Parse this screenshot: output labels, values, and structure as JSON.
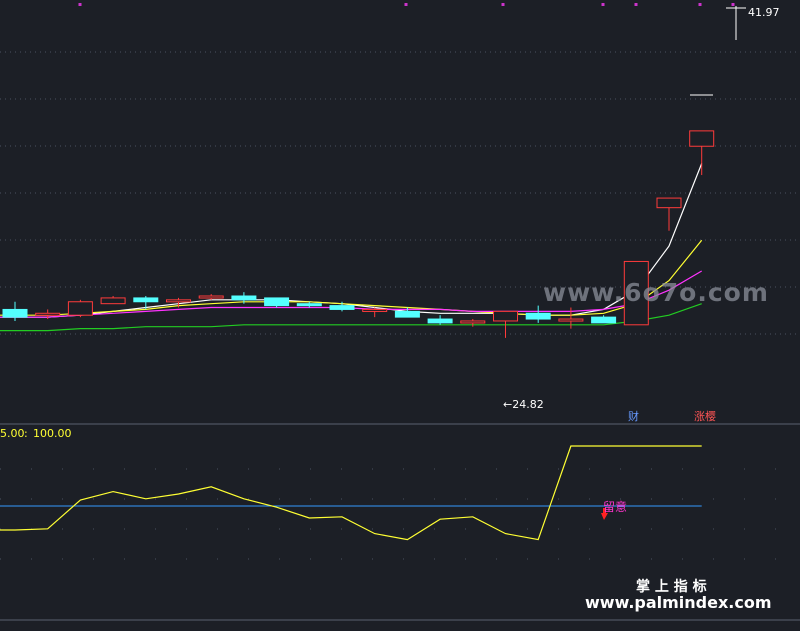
{
  "colors": {
    "background": "#1c1f26",
    "grid": "#4a5060",
    "up": "#ff3b3b",
    "down": "#54ffff",
    "ma_white": "#ffffff",
    "ma_yellow": "#ffff33",
    "ma_magenta": "#ff33ff",
    "ma_green": "#22cc22",
    "osc_line": "#ffff33",
    "osc_ref": "#3399ff",
    "signal_text": "#ff33cc",
    "signal_arrow": "#ff2222",
    "label_blue": "#6699ff",
    "label_red": "#ff5555",
    "watermark": "#8a8f99"
  },
  "chart_data": [
    {
      "type": "candlestick",
      "title": "",
      "ylim": [
        22,
        42
      ],
      "x": [
        "1",
        "2",
        "3",
        "4",
        "5",
        "6",
        "7",
        "8",
        "9",
        "10",
        "11",
        "12",
        "13",
        "14",
        "15",
        "16",
        "17",
        "18",
        "19",
        "20",
        "21",
        "22"
      ],
      "candles": [
        {
          "o": 26.3,
          "h": 26.7,
          "l": 25.7,
          "c": 25.9
        },
        {
          "o": 26.0,
          "h": 26.3,
          "l": 25.8,
          "c": 26.1
        },
        {
          "o": 26.0,
          "h": 26.8,
          "l": 25.9,
          "c": 26.7
        },
        {
          "o": 26.6,
          "h": 27.0,
          "l": 26.6,
          "c": 26.9
        },
        {
          "o": 26.9,
          "h": 27.0,
          "l": 26.3,
          "c": 26.7
        },
        {
          "o": 26.7,
          "h": 26.9,
          "l": 26.4,
          "c": 26.8
        },
        {
          "o": 26.9,
          "h": 27.1,
          "l": 26.8,
          "c": 27.0
        },
        {
          "o": 27.0,
          "h": 27.2,
          "l": 26.6,
          "c": 26.8
        },
        {
          "o": 26.9,
          "h": 26.9,
          "l": 26.4,
          "c": 26.5
        },
        {
          "o": 26.6,
          "h": 26.7,
          "l": 26.4,
          "c": 26.5
        },
        {
          "o": 26.5,
          "h": 26.7,
          "l": 26.2,
          "c": 26.3
        },
        {
          "o": 26.2,
          "h": 26.4,
          "l": 25.9,
          "c": 26.3
        },
        {
          "o": 26.2,
          "h": 26.4,
          "l": 25.9,
          "c": 25.9
        },
        {
          "o": 25.8,
          "h": 26.0,
          "l": 25.5,
          "c": 25.6
        },
        {
          "o": 25.6,
          "h": 25.8,
          "l": 25.4,
          "c": 25.7
        },
        {
          "o": 25.7,
          "h": 26.2,
          "l": 24.82,
          "c": 26.2
        },
        {
          "o": 26.1,
          "h": 26.5,
          "l": 25.6,
          "c": 25.8
        },
        {
          "o": 25.8,
          "h": 26.4,
          "l": 25.3,
          "c": 25.8
        },
        {
          "o": 25.9,
          "h": 26.0,
          "l": 25.6,
          "c": 25.6
        },
        {
          "o": 25.5,
          "h": 28.8,
          "l": 25.5,
          "c": 28.8
        },
        {
          "o": 31.6,
          "h": 31.6,
          "l": 30.4,
          "c": 32.1
        },
        {
          "o": 34.8,
          "h": 34.8,
          "l": 33.3,
          "c": 35.6
        }
      ],
      "series": [
        {
          "key": "white",
          "values": [
            25.9,
            25.9,
            26.0,
            26.2,
            26.4,
            26.6,
            26.8,
            26.8,
            26.8,
            26.7,
            26.6,
            26.4,
            26.2,
            26.1,
            26.1,
            26.1,
            26.0,
            26.0,
            26.3,
            27.3,
            29.6,
            33.9
          ]
        },
        {
          "key": "yellow",
          "values": [
            26.0,
            26.0,
            26.1,
            26.2,
            26.3,
            26.5,
            26.6,
            26.7,
            26.7,
            26.7,
            26.6,
            26.5,
            26.4,
            26.3,
            26.2,
            26.1,
            26.0,
            26.0,
            26.1,
            26.6,
            27.8,
            29.9
          ]
        },
        {
          "key": "magenta",
          "values": [
            25.9,
            25.9,
            26.0,
            26.1,
            26.2,
            26.3,
            26.4,
            26.4,
            26.4,
            26.4,
            26.4,
            26.3,
            26.3,
            26.3,
            26.2,
            26.2,
            26.2,
            26.2,
            26.3,
            26.6,
            27.3,
            28.3
          ]
        },
        {
          "key": "green",
          "values": [
            25.2,
            25.2,
            25.3,
            25.3,
            25.4,
            25.4,
            25.4,
            25.5,
            25.5,
            25.5,
            25.5,
            25.5,
            25.5,
            25.5,
            25.5,
            25.5,
            25.5,
            25.5,
            25.5,
            25.7,
            26.0,
            26.6
          ]
        }
      ],
      "annotations": {
        "high_label": "41.97",
        "low_label": "←24.82",
        "tag1": "财",
        "tag2": "涨樱"
      }
    },
    {
      "type": "line",
      "title": "",
      "header_left": "5.00",
      "header_sep": ":",
      "header_right": "100.00",
      "ylim": [
        0,
        100
      ],
      "reference_line": 50,
      "x": [
        "1",
        "2",
        "3",
        "4",
        "5",
        "6",
        "7",
        "8",
        "9",
        "10",
        "11",
        "12",
        "13",
        "14",
        "15",
        "16",
        "17",
        "18",
        "19",
        "20",
        "21",
        "22"
      ],
      "values": [
        30,
        31,
        55,
        62,
        56,
        60,
        66,
        56,
        49,
        40,
        41,
        27,
        22,
        39,
        41,
        27,
        22,
        100,
        100,
        100,
        100,
        100
      ],
      "signal_label": "留意"
    }
  ],
  "watermark": {
    "line1": "www.6o7o.com",
    "line2": "掌 上 指 标",
    "line3": "www.palmindex.com"
  }
}
